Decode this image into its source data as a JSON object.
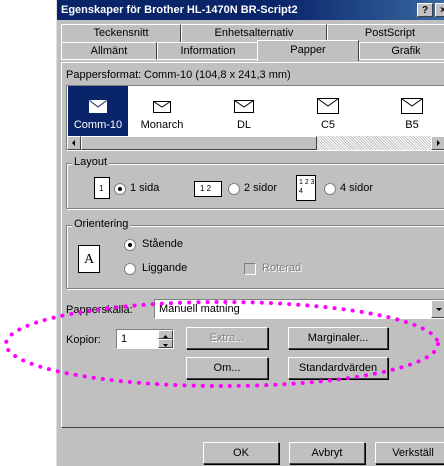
{
  "window": {
    "title": "Egenskaper för Brother HL-1470N BR-Script2",
    "help_btn": "?",
    "close_btn": "×"
  },
  "tabs_row1": [
    "Teckensnitt",
    "Enhetsalternativ",
    "PostScript"
  ],
  "tabs_row2": [
    "Allmänt",
    "Information",
    "Papper",
    "Grafik"
  ],
  "active_tab": "Papper",
  "paper": {
    "format_label": "Pappersformat:",
    "format_value": "Comm-10 (104,8 x 241,3 mm)",
    "sizes": [
      "Comm-10",
      "Monarch",
      "DL",
      "C5",
      "B5"
    ],
    "selected": "Comm-10"
  },
  "layout": {
    "label": "Layout",
    "options": [
      {
        "label": "1 sida",
        "icon_text": "1",
        "selected": true
      },
      {
        "label": "2 sidor",
        "icon_text": "1 2",
        "selected": false
      },
      {
        "label": "4 sidor",
        "icon_text": "1 2 3 4",
        "selected": false
      }
    ]
  },
  "orientation": {
    "label": "Orientering",
    "icon_text": "A",
    "options": [
      {
        "label": "Stående",
        "selected": true
      },
      {
        "label": "Liggande",
        "selected": false
      }
    ],
    "rotate_label": "Roterad"
  },
  "source": {
    "label": "Papperskälla:",
    "value": "Manuell matning"
  },
  "copies": {
    "label": "Kopior:",
    "value": "1"
  },
  "buttons": {
    "extra": "Extra...",
    "margins": "Marginaler...",
    "about": "Om...",
    "defaults": "Standardvärden",
    "ok": "OK",
    "cancel": "Avbryt",
    "apply": "Verkställ"
  },
  "colors": {
    "titlebar": "#0a246a",
    "dialog_bg": "#c0c0c0",
    "highlight_dots": "#ff00ff"
  }
}
